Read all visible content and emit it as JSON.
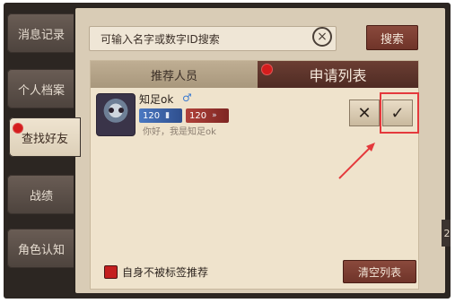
{
  "sidebar": {
    "tabs": [
      {
        "label": "消息记录"
      },
      {
        "label": "个人档案"
      },
      {
        "label": "查找好友"
      },
      {
        "label": "战绩"
      },
      {
        "label": "角色认知"
      }
    ]
  },
  "search": {
    "placeholder": "可输入名字或数字ID搜索",
    "clear_icon": "×",
    "button_label": "搜索"
  },
  "subtabs": {
    "left_label": "推荐人员",
    "right_label": "申请列表"
  },
  "request": {
    "nickname": "知足ok",
    "gender_icon": "♂",
    "badge1": "120",
    "badge2": "120",
    "message": "你好，我是知足ok",
    "reject_icon": "✕",
    "accept_icon": "✓"
  },
  "footer": {
    "checkbox_label": "自身不被标签推荐",
    "clear_button": "清空列表"
  },
  "colors": {
    "accent_red": "#d41d1d",
    "highlight": "#e4393c",
    "button_brown": "#7b3e32"
  }
}
